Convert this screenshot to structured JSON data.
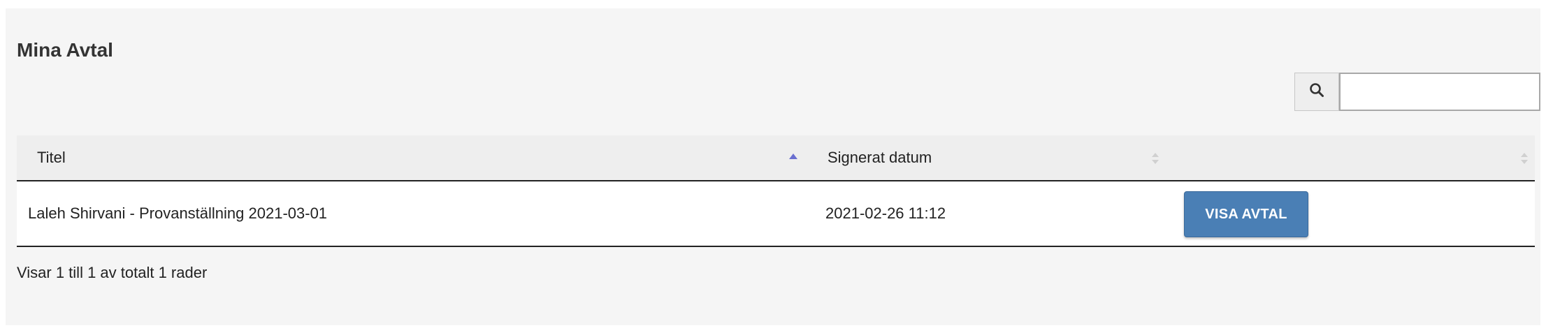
{
  "page": {
    "title": "Mina Avtal"
  },
  "search": {
    "placeholder": "",
    "value": "",
    "icon": "search-icon"
  },
  "table": {
    "columns": [
      {
        "label": "Titel",
        "sort": "ascending"
      },
      {
        "label": "Signerat datum",
        "sort": "none"
      },
      {
        "label": "",
        "sort": "none"
      }
    ],
    "rows": [
      {
        "title": "Laleh Shirvani - Provanställning 2021-03-01",
        "signed_date": "2021-02-26 11:12",
        "action_label": "VISA AVTAL"
      }
    ]
  },
  "footer": {
    "info": "Visar 1 till 1 av totalt 1 rader"
  },
  "colors": {
    "panel_background": "#f5f5f5",
    "header_background": "#eeeeee",
    "button_primary": "#4a7fb5",
    "sort_active": "#6a6fd0",
    "sort_inactive": "#d0d0d0"
  }
}
